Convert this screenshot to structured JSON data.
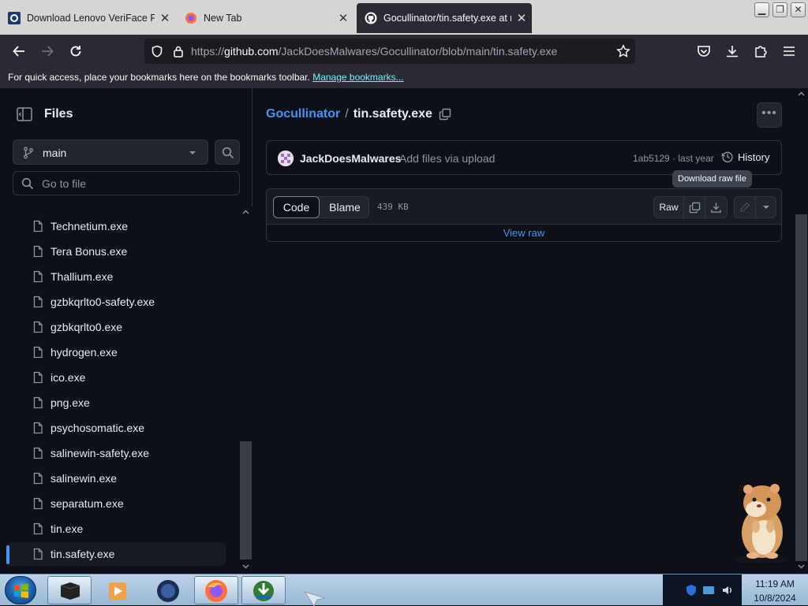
{
  "browser": {
    "tabs": [
      {
        "title": "Download Lenovo VeriFace Pro",
        "active": false
      },
      {
        "title": "New Tab",
        "active": false
      },
      {
        "title": "Gocullinator/tin.safety.exe at m",
        "active": true
      }
    ],
    "url_prefix": "https://",
    "url_host": "github.com",
    "url_path": "/JackDoesMalwares/Gocullinator/blob/main/tin.safety.exe",
    "bookmarks_text": "For quick access, place your bookmarks here on the bookmarks toolbar.",
    "bookmarks_link": "Manage bookmarks..."
  },
  "sidebar": {
    "title": "Files",
    "branch": "main",
    "goto_placeholder": "Go to file",
    "files": [
      "Technetium.exe",
      "Tera Bonus.exe",
      "Thallium.exe",
      "gzbkqrlto0-safety.exe",
      "gzbkqrlto0.exe",
      "hydrogen.exe",
      "ico.exe",
      "png.exe",
      "psychosomatic.exe",
      "salinewin-safety.exe",
      "salinewin.exe",
      "separatum.exe",
      "tin.exe",
      "tin.safety.exe"
    ],
    "active_file": "tin.safety.exe"
  },
  "main": {
    "repo": "Gocullinator",
    "separator": "/",
    "file": "tin.safety.exe",
    "commit": {
      "author": "JackDoesMalwares",
      "message": "Add files via upload",
      "sha_time": "1ab5129 · last year",
      "history_label": "History"
    },
    "tooltip": "Download raw file",
    "tabs": {
      "code": "Code",
      "blame": "Blame"
    },
    "size": "439 KB",
    "raw_label": "Raw",
    "view_raw": "View raw"
  },
  "taskbar": {
    "time": "11:19 AM",
    "date": "10/8/2024"
  },
  "colors": {
    "accent": "#4493f8",
    "background": "#0d1117",
    "border": "#30363d"
  }
}
